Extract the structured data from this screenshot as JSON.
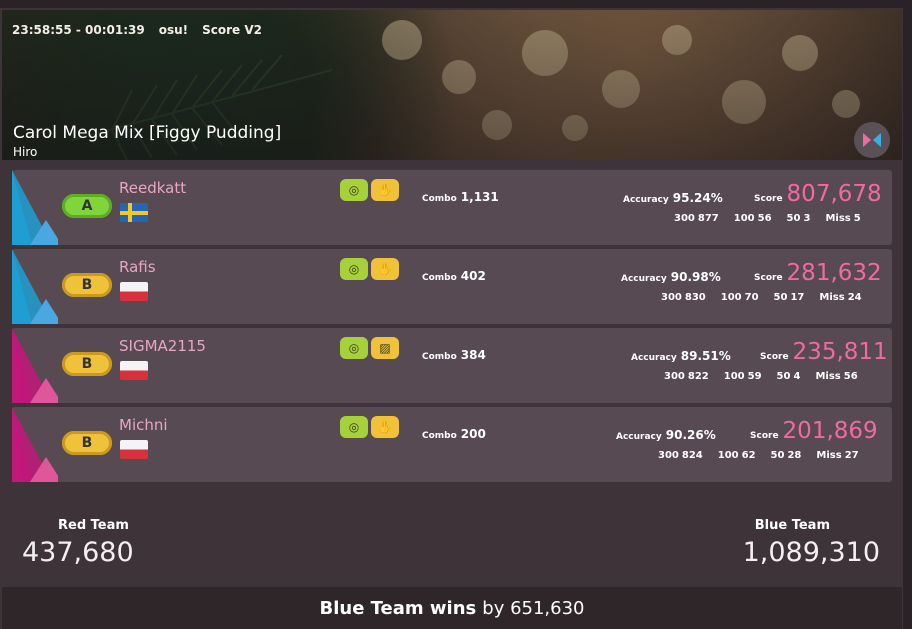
{
  "header": {
    "time_range": "23:58:55 - 00:01:39",
    "mode": "osu!",
    "scoring": "Score V2",
    "map_title": "Carol Mega Mix [Figgy Pudding]",
    "map_difficulty_author": "Hiro"
  },
  "labels": {
    "combo": "Combo",
    "accuracy": "Accuracy",
    "score": "Score",
    "h300": "300",
    "h100": "100",
    "h50": "50",
    "miss": "Miss"
  },
  "colors": {
    "blue_team": "#1f9ed2",
    "red_team": "#c2187a",
    "score_pink": "#f06aa2",
    "name_pink": "#e6a6c4"
  },
  "players": [
    {
      "name": "Reedkatt",
      "team": "blue",
      "grade": "A",
      "flag": "sweden-flag",
      "mods": [
        "gear-mod-icon",
        "hand-mod-icon"
      ],
      "combo": "1,131",
      "accuracy": "95.24%",
      "score": "807,678",
      "c300": "877",
      "c100": "56",
      "c50": "3",
      "miss": "5"
    },
    {
      "name": "Rafis",
      "team": "blue",
      "grade": "B",
      "flag": "poland-flag",
      "mods": [
        "gear-mod-icon",
        "hand-mod-icon"
      ],
      "combo": "402",
      "accuracy": "90.98%",
      "score": "281,632",
      "c300": "830",
      "c100": "70",
      "c50": "17",
      "miss": "24"
    },
    {
      "name": "SIGMA2115",
      "team": "red",
      "grade": "B",
      "flag": "poland-flag",
      "mods": [
        "gear-mod-icon",
        "stripes-mod-icon"
      ],
      "combo": "384",
      "accuracy": "89.51%",
      "score": "235,811",
      "c300": "822",
      "c100": "59",
      "c50": "4",
      "miss": "56"
    },
    {
      "name": "Michni",
      "team": "red",
      "grade": "B",
      "flag": "poland-flag",
      "mods": [
        "gear-mod-icon",
        "hand-mod-icon"
      ],
      "combo": "200",
      "accuracy": "90.26%",
      "score": "201,869",
      "c300": "824",
      "c100": "62",
      "c50": "28",
      "miss": "27"
    }
  ],
  "teams": {
    "red": {
      "name": "Red Team",
      "score": "437,680"
    },
    "blue": {
      "name": "Blue Team",
      "score": "1,089,310"
    }
  },
  "result": {
    "winner_text": "Blue Team wins",
    "by_text": "by 651,630"
  }
}
